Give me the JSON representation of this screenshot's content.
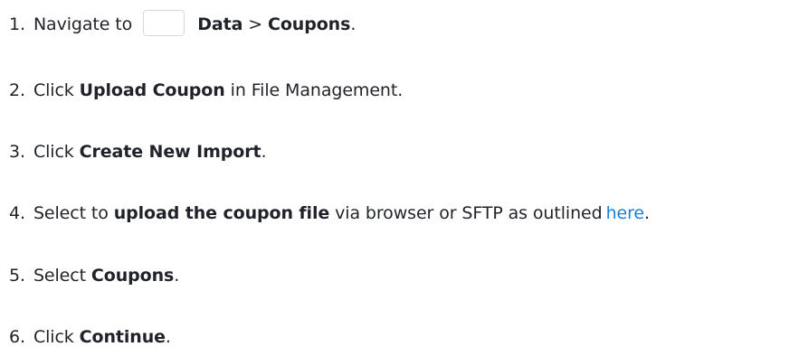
{
  "steps": [
    {
      "number": "1.",
      "text_before": "Navigate to",
      "bold_1": "Data",
      "separator": " > ",
      "bold_2": "Coupons",
      "text_after": "."
    },
    {
      "number": "2.",
      "text_before": "Click ",
      "bold": "Upload Coupon",
      "text_after": " in File Management."
    },
    {
      "number": "3.",
      "text_before": "Click ",
      "bold": "Create New Import",
      "text_after": "."
    },
    {
      "number": "4.",
      "text_before": "Select to ",
      "bold": "upload the coupon file",
      "text_after": " via browser or SFTP as outlined",
      "link": "here",
      "text_end": "."
    },
    {
      "number": "5.",
      "text_before": "Select ",
      "bold": "Coupons",
      "text_after": "."
    },
    {
      "number": "6.",
      "text_before": "Click ",
      "bold": "Continue",
      "text_after": "."
    }
  ],
  "colors": {
    "text": "#1f2329",
    "link": "#1a7fd6",
    "icon_border": "#d5d9de"
  },
  "icons": {
    "step_1_inline_icon": "navigation-menu-icon"
  }
}
